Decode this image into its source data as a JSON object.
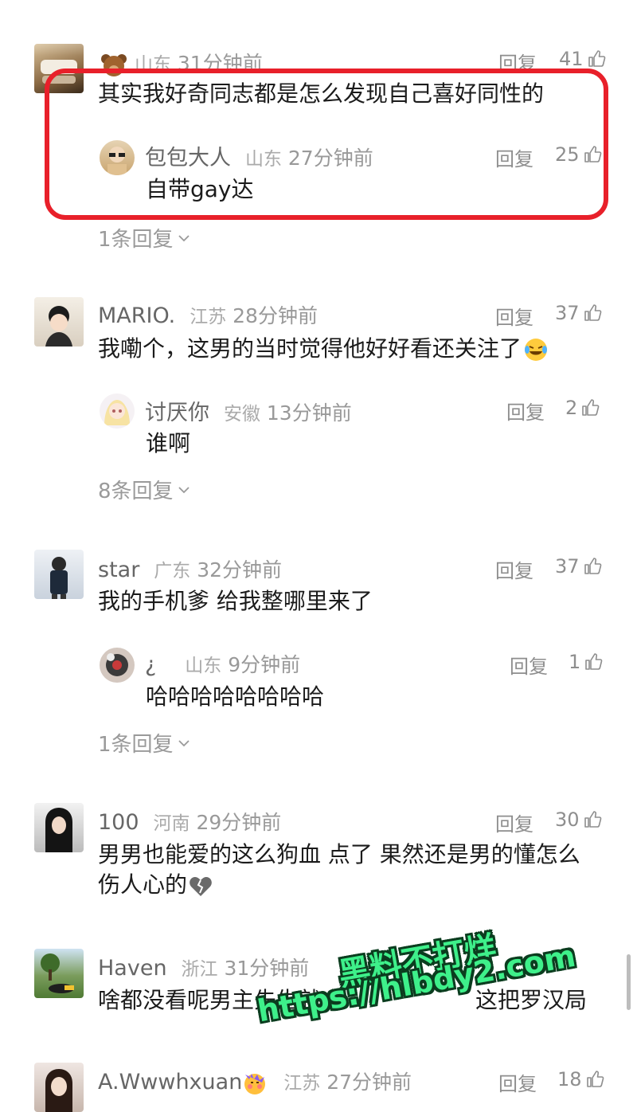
{
  "comments": [
    {
      "loc": "山东",
      "time": "31分钟前",
      "reply_label": "回复",
      "likes": "41",
      "text": "其实我好奇同志都是怎么发现自己喜好同性的",
      "reply": {
        "nick": "包包大人",
        "loc": "山东",
        "time": "27分钟前",
        "reply_label": "回复",
        "likes": "25",
        "text": "自带gay达"
      },
      "more": "1条回复"
    },
    {
      "nick": "MARIO.",
      "loc": "江苏",
      "time": "28分钟前",
      "reply_label": "回复",
      "likes": "37",
      "text": "我嘞个，这男的当时觉得他好好看还关注了",
      "reply": {
        "nick": "讨厌你",
        "loc": "安徽",
        "time": "13分钟前",
        "reply_label": "回复",
        "likes": "2",
        "text": "谁啊"
      },
      "more": "8条回复"
    },
    {
      "nick": "star",
      "loc": "广东",
      "time": "32分钟前",
      "reply_label": "回复",
      "likes": "37",
      "text": "我的手机爹 给我整哪里来了",
      "reply": {
        "nick": "¿",
        "loc": "山东",
        "time": "9分钟前",
        "reply_label": "回复",
        "likes": "1",
        "text": "哈哈哈哈哈哈哈哈"
      },
      "more": "1条回复"
    },
    {
      "nick": "100",
      "loc": "河南",
      "time": "29分钟前",
      "reply_label": "回复",
      "likes": "30",
      "text_line1": "男男也能爱的这么狗血 点了 果然还是男的懂怎么",
      "text_line2": "伤人心的"
    },
    {
      "nick": "Haven",
      "loc": "浙江",
      "time": "31分钟前",
      "text": "啥都没看呢男主先生就令",
      "text_end": "这把罗汉局"
    },
    {
      "nick": "A.Wwwhxuan",
      "loc": "江苏",
      "time": "27分钟前",
      "reply_label": "回复",
      "likes": "18"
    }
  ],
  "watermark": {
    "line1": "黑料不打烊",
    "line2": "https://hlbdy2.com"
  },
  "colors": {
    "highlight": "#e8202a",
    "watermark": "#3ef08a"
  }
}
